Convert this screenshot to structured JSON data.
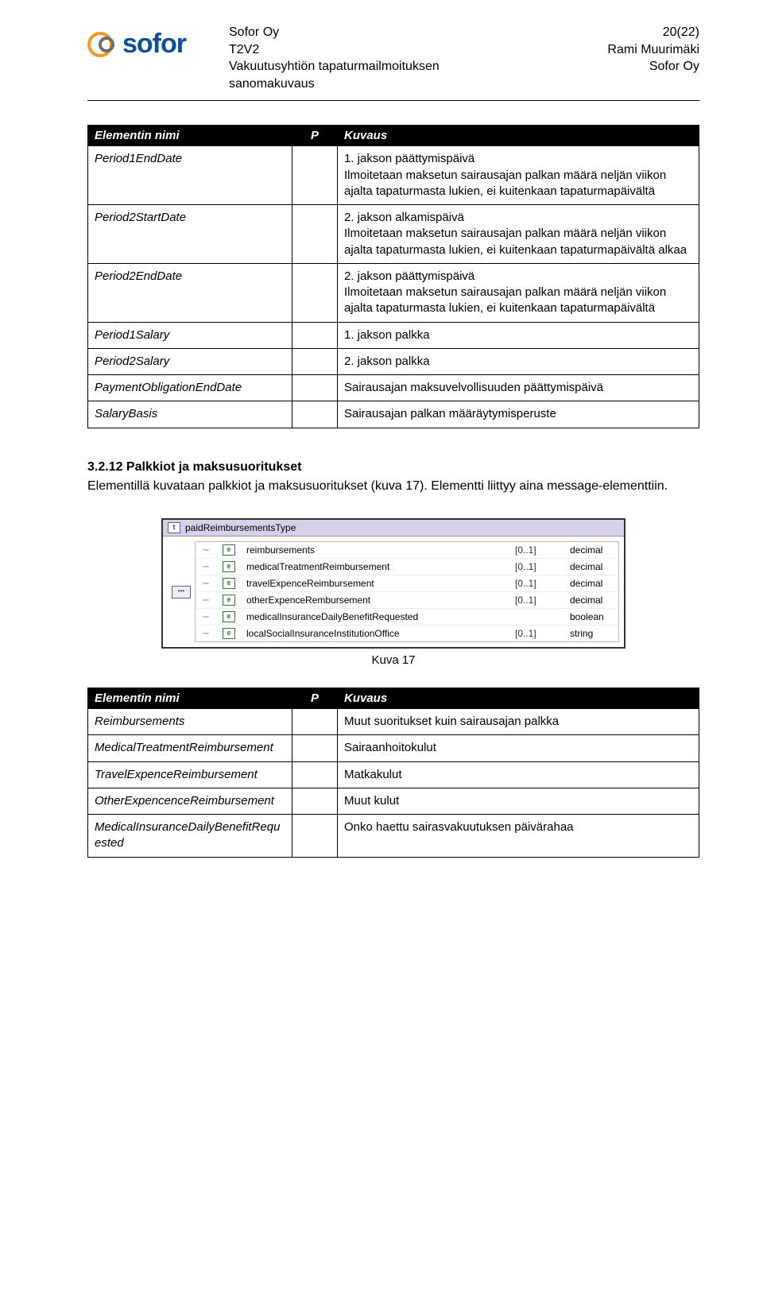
{
  "header": {
    "brand": "sofor",
    "company": "Sofor Oy",
    "doc_code": "T2V2",
    "doc_title_line1": "Vakuutusyhtiön tapaturmailmoituksen",
    "doc_title_line2": "sanomakuvaus",
    "page_num": "20(22)",
    "author": "Rami Muurimäki",
    "author_company": "Sofor Oy"
  },
  "table1_headers": {
    "name": "Elementin nimi",
    "p": "P",
    "desc": "Kuvaus"
  },
  "table1": [
    {
      "name": "Period1EndDate",
      "desc": "1. jakson päättymispäivä\nIlmoitetaan maksetun sairausajan palkan määrä neljän viikon ajalta tapaturmasta lukien, ei kuitenkaan tapaturmapäivältä"
    },
    {
      "name": "Period2StartDate",
      "desc": "2. jakson alkamispäivä\nIlmoitetaan maksetun sairausajan palkan määrä neljän viikon ajalta tapaturmasta lukien, ei kuitenkaan tapaturmapäivältä alkaa"
    },
    {
      "name": "Period2EndDate",
      "desc": "2. jakson päättymispäivä\nIlmoitetaan maksetun sairausajan palkan määrä neljän viikon ajalta tapaturmasta lukien, ei kuitenkaan tapaturmapäivältä"
    },
    {
      "name": "Period1Salary",
      "desc": "1. jakson palkka"
    },
    {
      "name": "Period2Salary",
      "desc": "2. jakson palkka"
    },
    {
      "name": "PaymentObligationEndDate",
      "desc": "Sairausajan maksuvelvollisuuden päättymispäivä"
    },
    {
      "name": "SalaryBasis",
      "desc": "Sairausajan palkan määräytymisperuste"
    }
  ],
  "section": {
    "heading": "3.2.12 Palkkiot ja maksusuoritukset",
    "body": "Elementillä kuvataan palkkiot ja maksusuoritukset (kuva 17). Elementti liittyy aina message-elementtiin."
  },
  "schema": {
    "title": "paidReimbursementsType",
    "rows": [
      {
        "name": "reimbursements",
        "card": "[0..1]",
        "type": "decimal"
      },
      {
        "name": "medicalTreatmentReimbursement",
        "card": "[0..1]",
        "type": "decimal"
      },
      {
        "name": "travelExpenceReimbursement",
        "card": "[0..1]",
        "type": "decimal"
      },
      {
        "name": "otherExpenceRembursement",
        "card": "[0..1]",
        "type": "decimal"
      },
      {
        "name": "medicalInsuranceDailyBenefitRequested",
        "card": "",
        "type": "boolean"
      },
      {
        "name": "localSocialInsuranceInstitutionOffice",
        "card": "[0..1]",
        "type": "string"
      }
    ],
    "caption": "Kuva 17"
  },
  "table2_headers": {
    "name": "Elementin nimi",
    "p": "P",
    "desc": "Kuvaus"
  },
  "table2": [
    {
      "name": "Reimbursements",
      "desc": "Muut suoritukset kuin sairausajan palkka"
    },
    {
      "name": "MedicalTreatmentReimbursement",
      "desc": "Sairaanhoitokulut"
    },
    {
      "name": "TravelExpenceReimbursement",
      "desc": "Matkakulut"
    },
    {
      "name": "OtherExpencenceReimbursement",
      "desc": "Muut kulut"
    },
    {
      "name": "MedicalInsuranceDailyBenefitRequested",
      "desc": "Onko haettu sairasvakuutuksen päivärahaa"
    }
  ]
}
